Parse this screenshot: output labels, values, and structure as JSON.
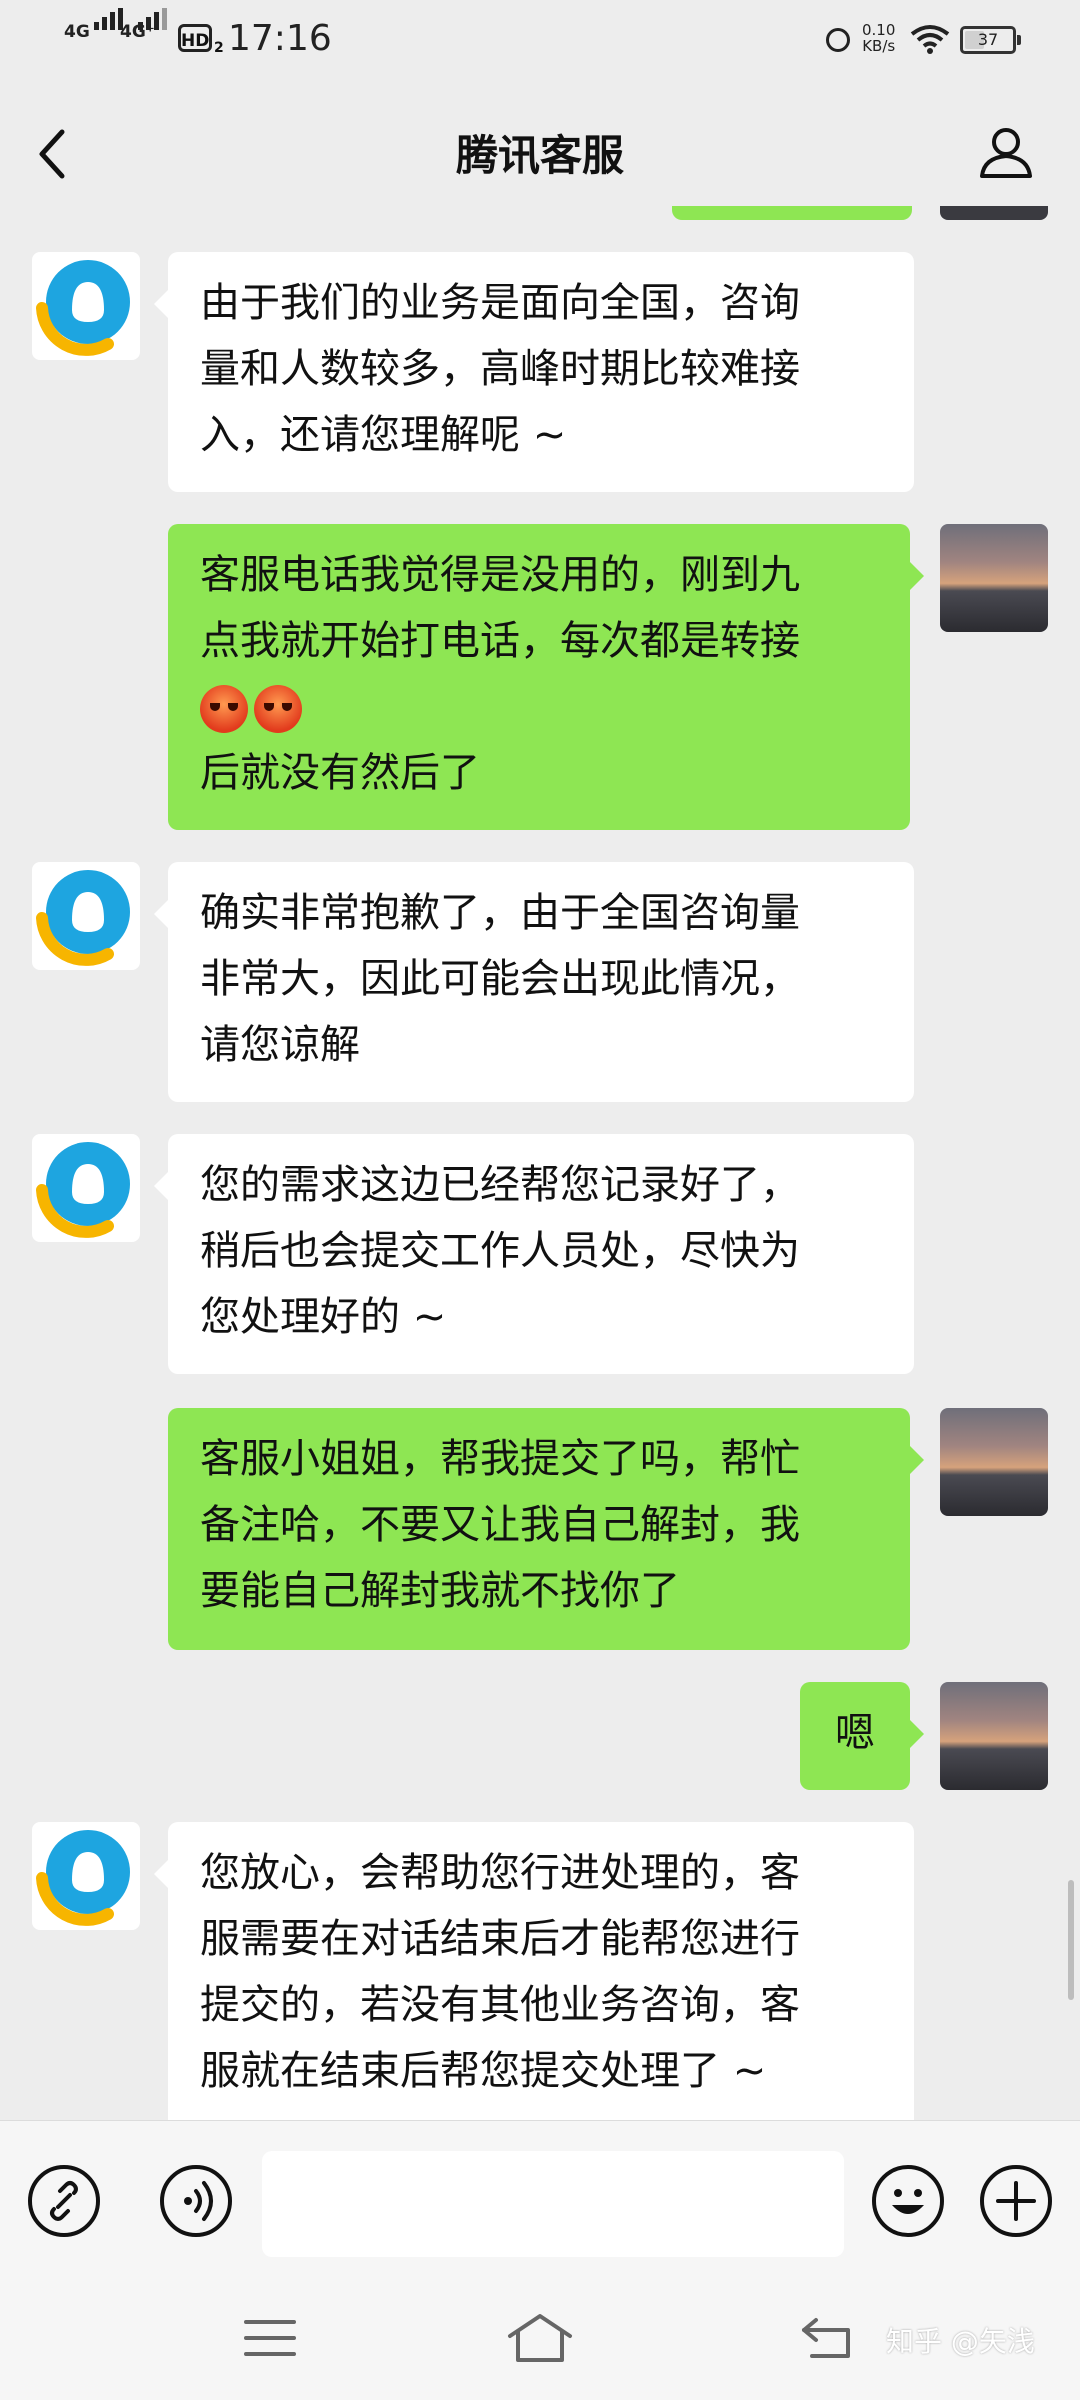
{
  "status_bar": {
    "net1": "4G",
    "net2": "4G⁺",
    "hd": "HD",
    "hd_sub": "2",
    "time": "17:16",
    "speed_value": "0.10",
    "speed_unit": "KB/s",
    "battery": "37"
  },
  "header": {
    "title": "腾讯客服"
  },
  "messages": [
    {
      "from": "agent",
      "text": "由于我们的业务是面向全国，咨询\n量和人数较多，高峰时期比较难接\n入，还请您理解呢 ~"
    },
    {
      "from": "user",
      "text_lines": [
        "客服电话我觉得是没用的，刚到九",
        "点我就开始打电话，每次都是转接",
        "后就没有然后了"
      ],
      "emoji": "angry-face"
    },
    {
      "from": "agent",
      "text": "确实非常抱歉了，由于全国咨询量\n非常大，因此可能会出现此情况，\n请您谅解"
    },
    {
      "from": "agent",
      "text": "您的需求这边已经帮您记录好了，\n稍后也会提交工作人员处，尽快为\n您处理好的 ~"
    },
    {
      "from": "user",
      "text": "客服小姐姐，帮我提交了吗，帮忙\n备注哈，不要又让我自己解封，我\n要能自己解封我就不找你了"
    },
    {
      "from": "user",
      "text": "嗯"
    },
    {
      "from": "agent",
      "text": "您放心，会帮助您行进处理的，客\n服需要在对话结束后才能帮您进行\n提交的，若没有其他业务咨询，客\n服就在结束后帮您提交处理了 ~"
    }
  ],
  "input_bar": {
    "placeholder": ""
  },
  "watermark": "知乎 @矢浅",
  "colors": {
    "background": "#ededed",
    "bubble_incoming": "#ffffff",
    "bubble_outgoing": "#8ee653",
    "bot_avatar_blue": "#1ea5e0",
    "bot_avatar_yellow": "#f7b500"
  }
}
